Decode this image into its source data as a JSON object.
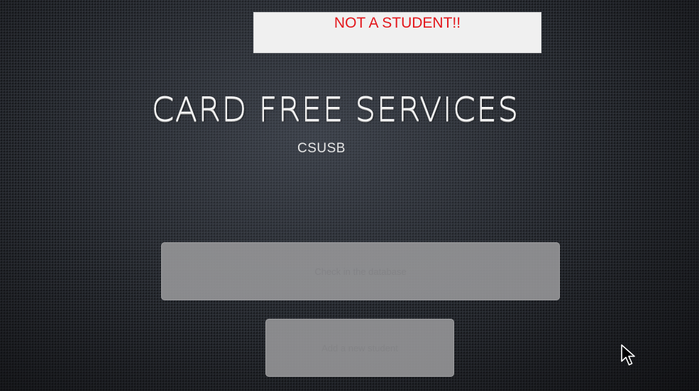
{
  "alert": {
    "message": "NOT A STUDENT!!",
    "color": "#e3161b"
  },
  "header": {
    "title": "CARD FREE SERVICES",
    "subtitle": "CSUSB"
  },
  "actions": {
    "check_label": "Check in the database",
    "add_label": "Add a new student"
  },
  "cursor": {
    "icon": "mouse-pointer-icon"
  }
}
